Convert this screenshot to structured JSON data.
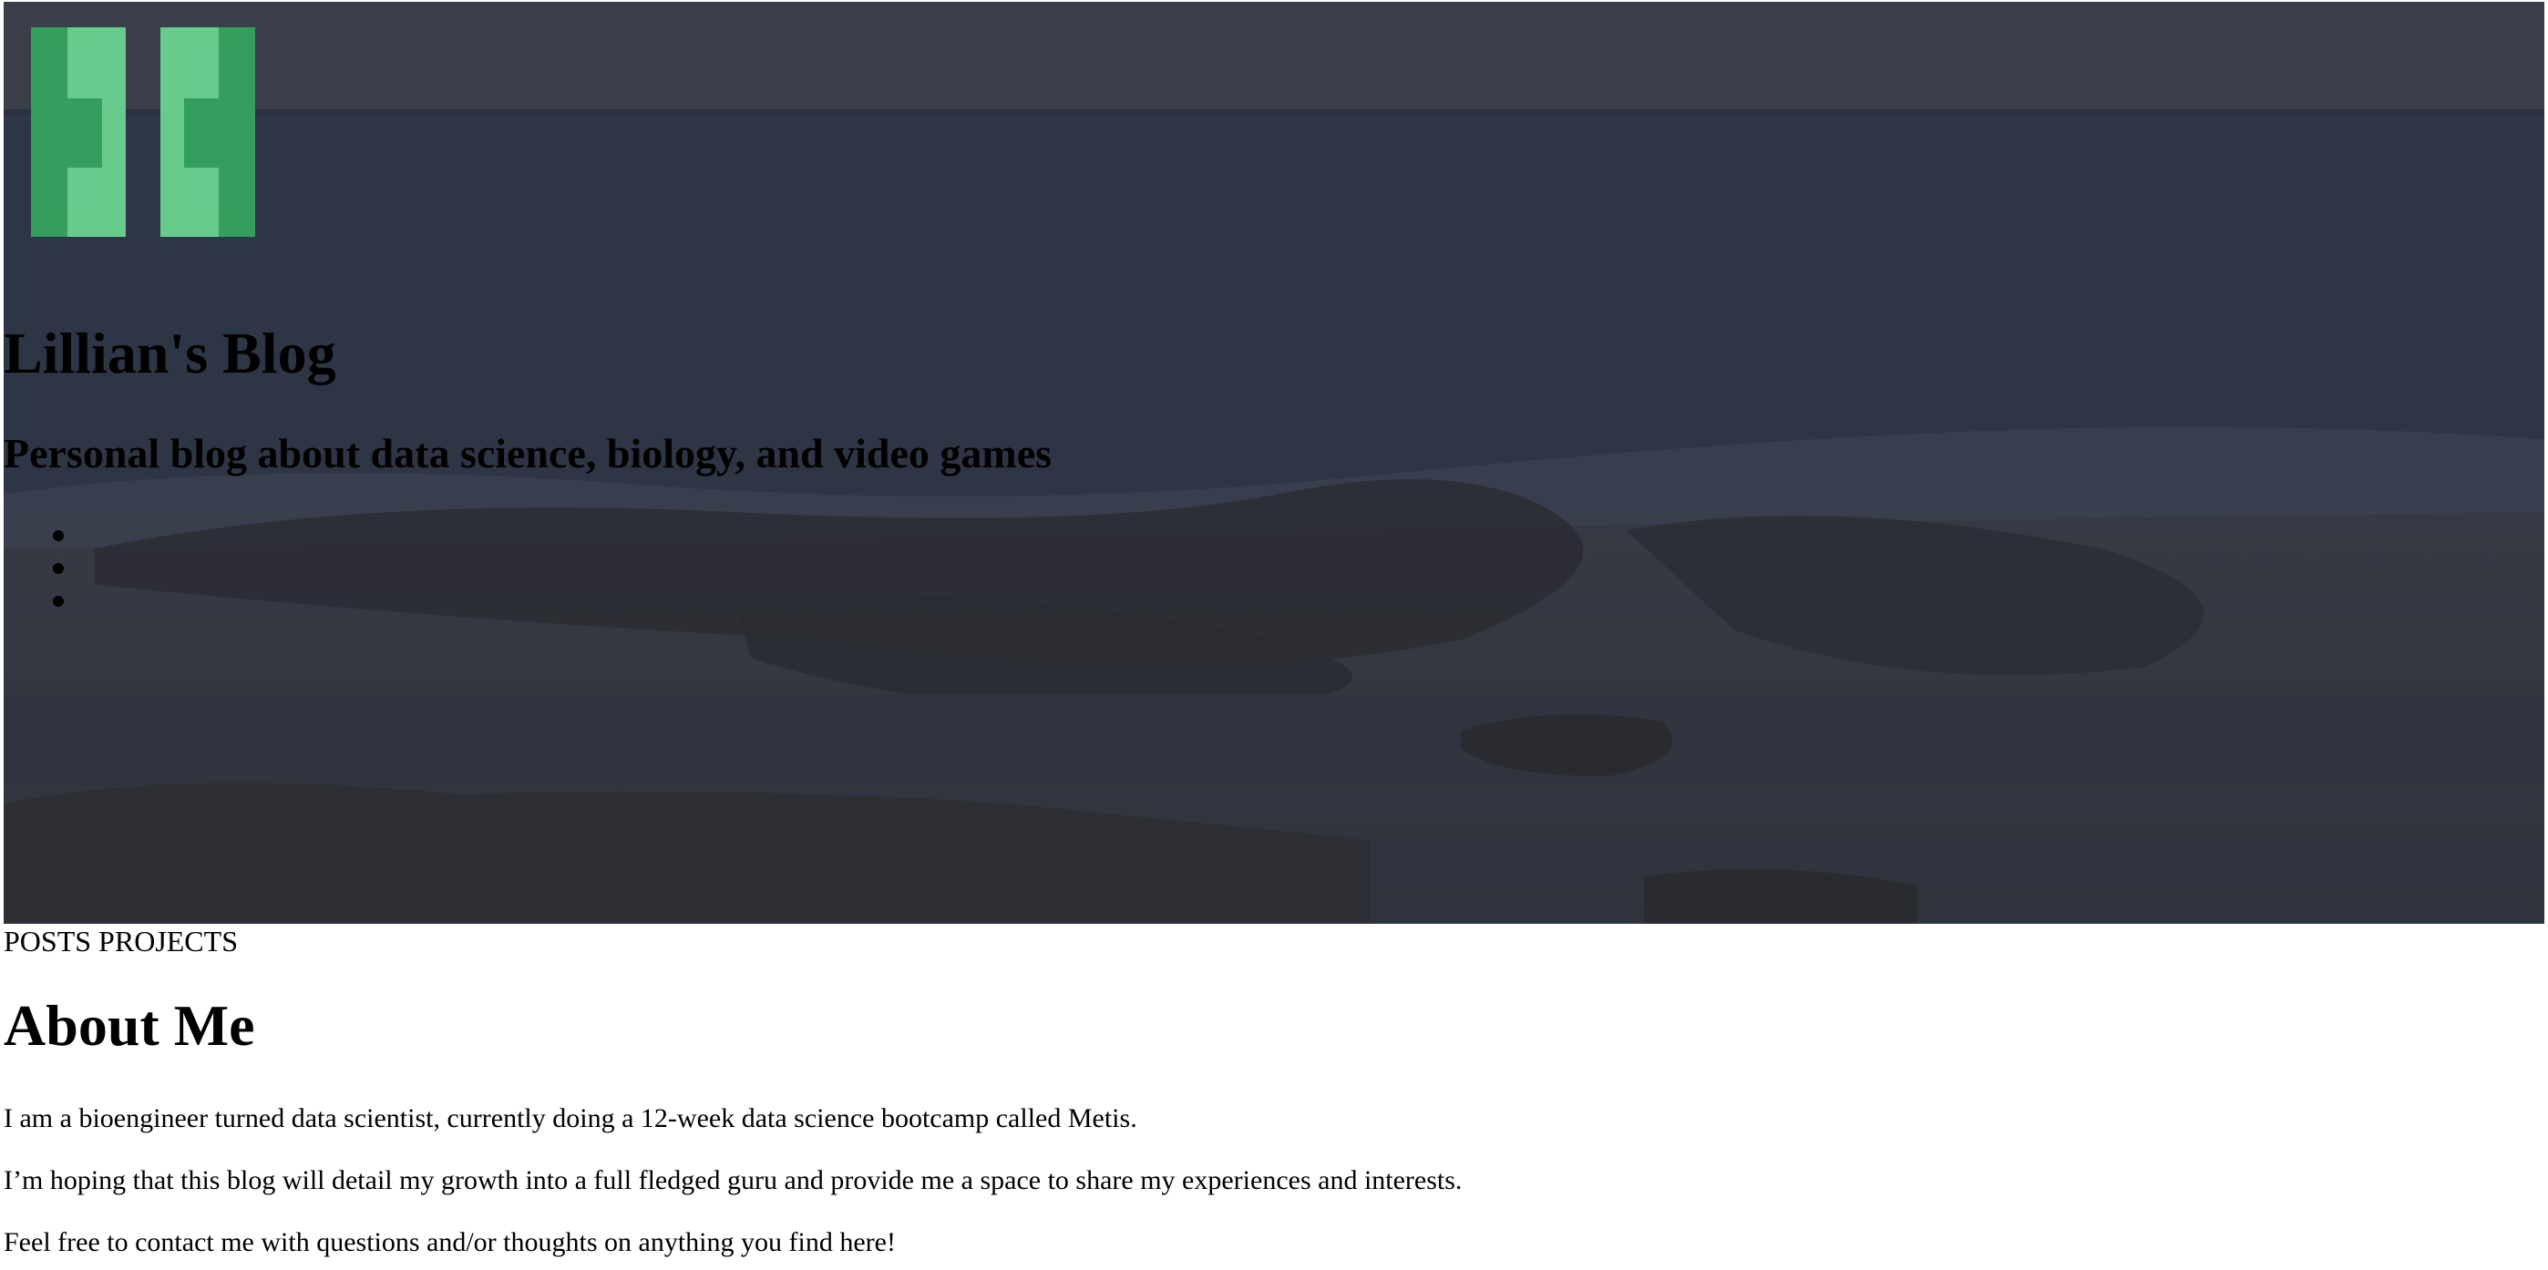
{
  "header": {
    "logo_icon": "double-bracket-logo-icon",
    "title": "Lillian's Blog",
    "subtitle": "Personal blog about data science, biology, and video games",
    "social_items": [
      "",
      "",
      ""
    ]
  },
  "nav": {
    "posts_label": "POSTS",
    "projects_label": "PROJECTS"
  },
  "about": {
    "title": "About Me",
    "paragraphs": [
      "I am a bioengineer turned data scientist, currently doing a 12-week data science bootcamp called Metis.",
      "I’m hoping that this blog will detail my growth into a full fledged guru and provide me a space to share my experiences and interests.",
      "Feel free to contact me with questions and/or thoughts on anything you find here!"
    ]
  },
  "colors": {
    "logo_dark_green": "#349e5c",
    "logo_light_green": "#67cb8c",
    "hero_overlay": "#2f3440"
  }
}
